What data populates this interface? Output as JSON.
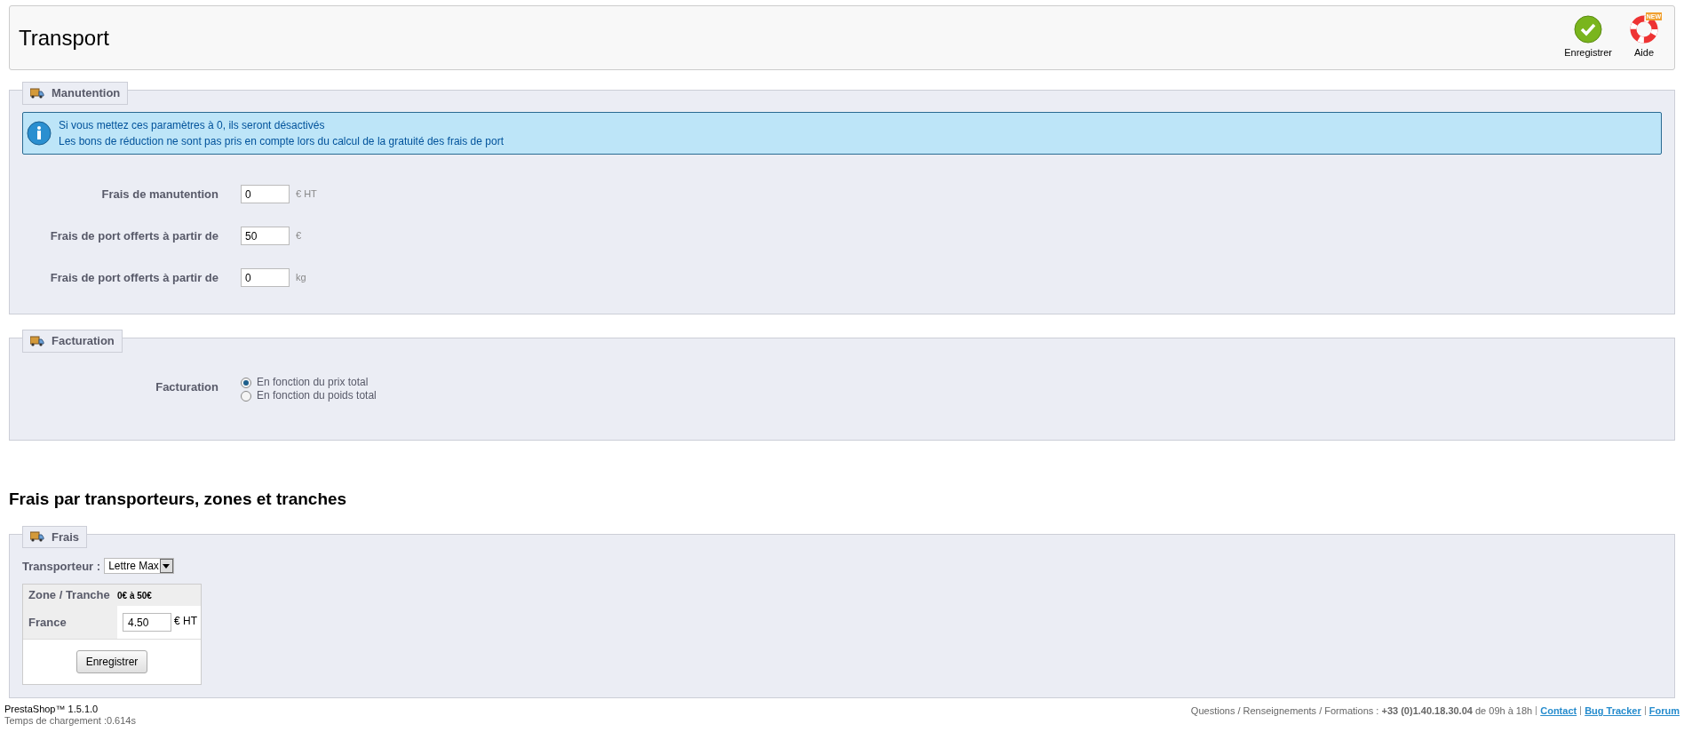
{
  "header": {
    "title": "Transport",
    "actions": [
      {
        "kind": "save",
        "label": "Enregistrer"
      },
      {
        "kind": "help",
        "label": "Aide",
        "badge": "NEW"
      }
    ]
  },
  "handling": {
    "legend": "Manutention",
    "info": [
      "Si vous mettez ces paramètres à 0, ils seront désactivés",
      "Les bons de réduction ne sont pas pris en compte lors du calcul de la gratuité des frais de port"
    ],
    "fields": [
      {
        "label": "Frais de manutention",
        "value": "0",
        "unit": "€ HT"
      },
      {
        "label": "Frais de port offerts à partir de",
        "value": "50",
        "unit": "€"
      },
      {
        "label": "Frais de port offerts à partir de",
        "value": "0",
        "unit": "kg"
      }
    ]
  },
  "billing": {
    "legend": "Facturation",
    "label": "Facturation",
    "options": [
      {
        "label": "En fonction du prix total",
        "selected": true
      },
      {
        "label": "En fonction du poids total",
        "selected": false
      }
    ]
  },
  "fees": {
    "heading": "Frais par transporteurs, zones et tranches",
    "legend": "Frais",
    "carrier_label": "Transporteur :",
    "carrier_value": "Lettre Max",
    "table": {
      "header": [
        "Zone / Tranche",
        "0€ à 50€"
      ],
      "rows": [
        {
          "zone": "France",
          "value": "4.50",
          "unit": "€ HT"
        }
      ],
      "button": "Enregistrer"
    }
  },
  "footer": {
    "version": "PrestaShop™ 1.5.1.0",
    "load_time": "Temps de chargement :0.614s",
    "contact": "Questions / Renseignements / Formations : **+33 (0)1.40.18.30.04** de 09h à 18h",
    "links": [
      "Contact",
      "Bug Tracker",
      "Forum"
    ]
  }
}
